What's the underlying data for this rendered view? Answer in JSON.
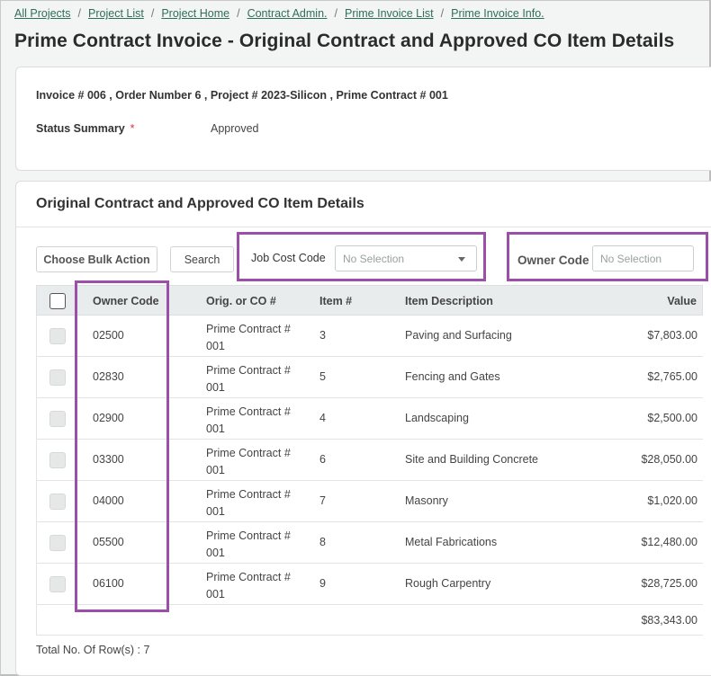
{
  "breadcrumb": [
    "All Projects",
    "Project List",
    "Project Home",
    "Contract Admin.",
    "Prime Invoice List",
    "Prime Invoice Info."
  ],
  "page_title": "Prime Contract Invoice - Original Contract and Approved CO Item Details",
  "invoice_info": "Invoice # 006 , Order Number 6 , Project # 2023-Silicon , Prime Contract # 001",
  "status": {
    "label": "Status Summary",
    "required_mark": "*",
    "value": "Approved"
  },
  "section_title": "Original Contract and Approved CO Item Details",
  "toolbar": {
    "bulk_action_label": "Choose Bulk Action",
    "search_label": "Search",
    "job_cost_label": "Job Cost Code",
    "job_cost_placeholder": "No Selection",
    "owner_code_label": "Owner Code",
    "owner_code_placeholder": "No Selection"
  },
  "columns": {
    "owner_code": "Owner Code",
    "orig_co": "Orig. or CO #",
    "item": "Item #",
    "description": "Item Description",
    "value": "Value"
  },
  "rows": [
    {
      "owner_code": "02500",
      "orig_1": "Prime Contract #",
      "orig_2": "001",
      "item": "3",
      "description": "Paving and Surfacing",
      "value": "$7,803.00"
    },
    {
      "owner_code": "02830",
      "orig_1": "Prime Contract #",
      "orig_2": "001",
      "item": "5",
      "description": "Fencing and Gates",
      "value": "$2,765.00"
    },
    {
      "owner_code": "02900",
      "orig_1": "Prime Contract #",
      "orig_2": "001",
      "item": "4",
      "description": "Landscaping",
      "value": "$2,500.00"
    },
    {
      "owner_code": "03300",
      "orig_1": "Prime Contract #",
      "orig_2": "001",
      "item": "6",
      "description": "Site and Building Concrete",
      "value": "$28,050.00"
    },
    {
      "owner_code": "04000",
      "orig_1": "Prime Contract #",
      "orig_2": "001",
      "item": "7",
      "description": "Masonry",
      "value": "$1,020.00"
    },
    {
      "owner_code": "05500",
      "orig_1": "Prime Contract #",
      "orig_2": "001",
      "item": "8",
      "description": "Metal Fabrications",
      "value": "$12,480.00"
    },
    {
      "owner_code": "06100",
      "orig_1": "Prime Contract #",
      "orig_2": "001",
      "item": "9",
      "description": "Rough Carpentry",
      "value": "$28,725.00"
    }
  ],
  "total_value": "$83,343.00",
  "row_count_text": "Total No. Of Row(s) : 7",
  "colors": {
    "link": "#2f6f5a",
    "highlight": "#9b4fa8",
    "required": "#dd3333",
    "header_bg": "#e9ecec"
  }
}
